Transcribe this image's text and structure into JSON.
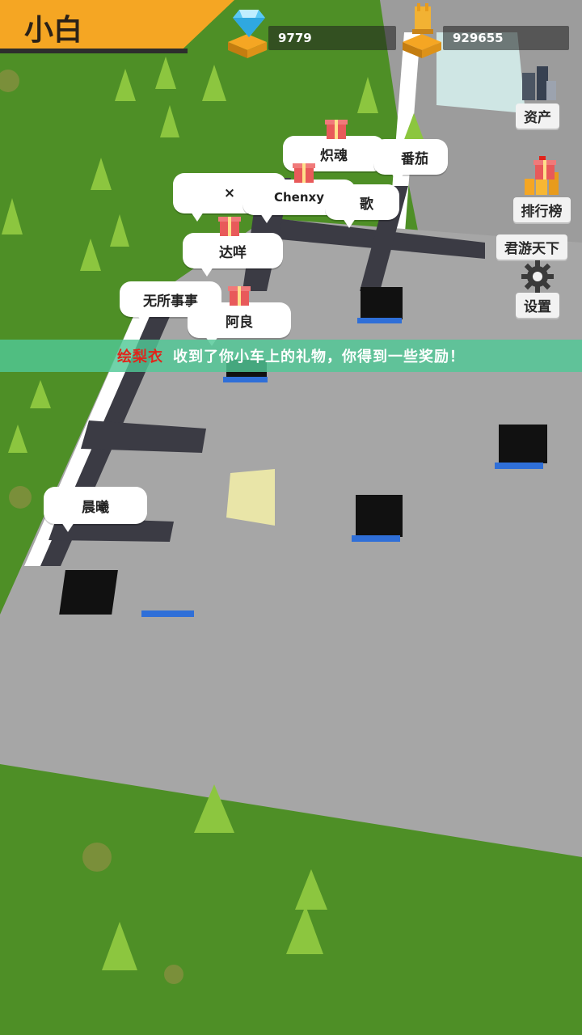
{
  "player": {
    "name": "小白"
  },
  "currencies": [
    {
      "icon": "diamond-icon",
      "value": "9779"
    },
    {
      "icon": "gold-trophy-icon",
      "value": "929655"
    }
  ],
  "side_menu": {
    "assets": "资产",
    "leaderboard": "排行榜",
    "leaderboard_caption": "君游天下",
    "settings": "设置"
  },
  "bubbles": [
    {
      "label": "炽魂"
    },
    {
      "label": "番茄"
    },
    {
      "label": "×"
    },
    {
      "label": "Chenxy"
    },
    {
      "label": "歌"
    },
    {
      "label": "达咩"
    },
    {
      "label": "无所事事"
    },
    {
      "label": "阿良"
    },
    {
      "label": "晨曦"
    }
  ],
  "notification": {
    "sender": "绘梨衣",
    "message": "收到了你小车上的礼物，你得到一些奖励！"
  },
  "colors": {
    "grass": "#4e8f26",
    "road": "#a6a6a6",
    "header": "#f5a623",
    "notify_bg": "#50c896",
    "notify_sender": "#e2231a"
  }
}
